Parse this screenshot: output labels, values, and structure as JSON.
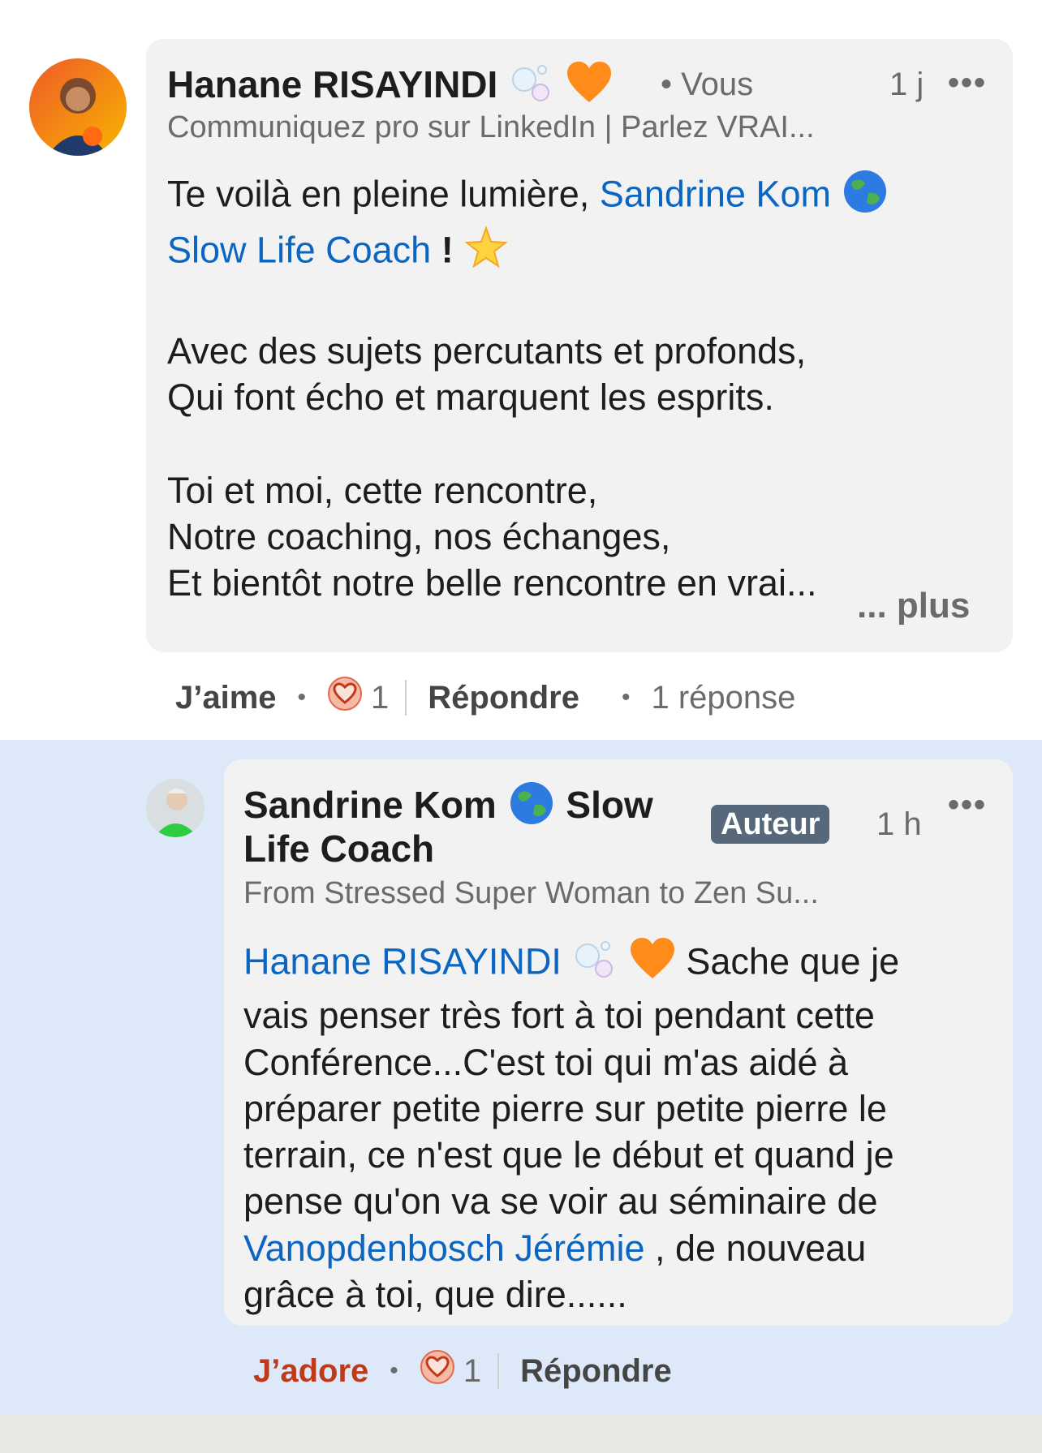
{
  "comment": {
    "author": "Hanane RISAYINDI",
    "author_suffix": "• Vous",
    "time": "1 j",
    "more": "•••",
    "headline": "Communiquez pro sur LinkedIn | Parlez VRAI...",
    "body": {
      "line1_text": "Te voilà en pleine lumière, ",
      "mention1": "Sandrine Kom",
      "mention1b": "Slow Life Coach",
      "line2_tail": " ! ",
      "stanza1": [
        "Avec des sujets percutants et profonds,",
        "Qui font écho et marquent les esprits."
      ],
      "stanza2": [
        "Toi et moi, cette rencontre,",
        "Notre coaching, nos échanges,",
        "Et bientôt notre belle rencontre en vrai..."
      ]
    },
    "see_more": "... plus",
    "actions": {
      "like": "J’aime",
      "reaction_count": "1",
      "reply": "Répondre",
      "replies": "1 réponse"
    }
  },
  "reply": {
    "author_line1": "Sandrine Kom",
    "author_line1b": "Slow",
    "author_line2": "Life Coach",
    "badge": "Auteur",
    "time": "1 h",
    "more": "•••",
    "headline": "From Stressed Super Woman to Zen Su...",
    "body": {
      "mention1": "Hanane RISAYINDI",
      "text1": " Sache que je",
      "lines": [
        "vais penser très fort à toi pendant cette",
        "Conférence...C'est toi qui m'as aidé à",
        "préparer petite pierre sur petite pierre le",
        "terrain, ce n'est que le début et quand je",
        "pense qu'on va se voir au séminaire de"
      ],
      "mention2": "Vanopdenbosch Jérémie",
      "text2": " , de nouveau",
      "last_line": "grâce à toi, que dire......"
    },
    "actions": {
      "like": "J’adore",
      "reaction_count": "1",
      "reply": "Répondre"
    }
  },
  "colors": {
    "mention": "#0a66c2",
    "reply_bg": "#dde9f8",
    "bubble_bg": "#f2f2f2",
    "love_red": "#c0391b",
    "badge_bg": "#56687a"
  }
}
